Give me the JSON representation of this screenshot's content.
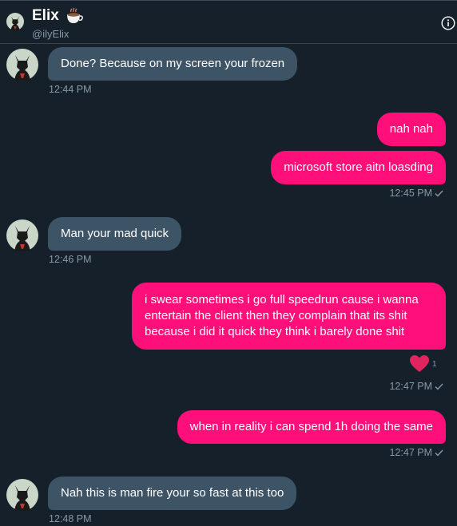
{
  "header": {
    "name": "Elix",
    "handle": "@ilyElix",
    "name_emoji": "coffee-cup-icon",
    "info_icon": "info-icon"
  },
  "colors": {
    "background": "#15202b",
    "incoming_bubble": "#3d5466",
    "outgoing_bubble": "#fe0f7a",
    "timestamp": "#8899a6",
    "heart": "#e0245e"
  },
  "messages": [
    {
      "direction": "in",
      "text": "Done? Because on my screen your frozen",
      "time": "12:44 PM"
    },
    {
      "direction": "out",
      "text": "nah nah"
    },
    {
      "direction": "out",
      "text": "microsoft store aitn loasding",
      "time": "12:45 PM"
    },
    {
      "direction": "in",
      "text": "Man your mad quick",
      "time": "12:46 PM"
    },
    {
      "direction": "out",
      "text": "i swear sometimes i go full speedrun cause i wanna entertain the client then they complain that its shit because i did it quick they think i barely done shit",
      "reaction": {
        "icon": "heart-icon",
        "count": "1"
      },
      "time": "12:47 PM"
    },
    {
      "direction": "out",
      "text": "when in reality i can spend 1h doing the same",
      "time": "12:47 PM"
    },
    {
      "direction": "in",
      "text": "Nah this is man fire your so fast at this too",
      "time": "12:48 PM"
    }
  ]
}
